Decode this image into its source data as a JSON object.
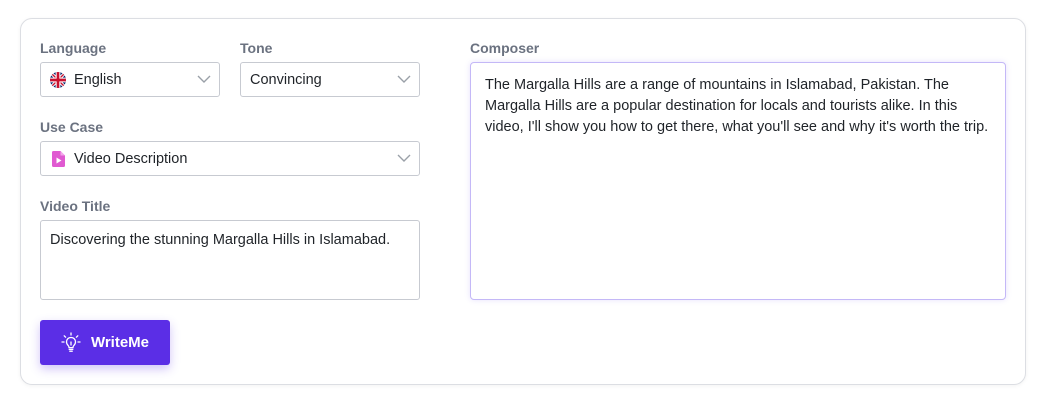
{
  "fields": {
    "language": {
      "label": "Language",
      "value": "English",
      "icon": "uk-flag-icon"
    },
    "tone": {
      "label": "Tone",
      "value": "Convincing"
    },
    "use_case": {
      "label": "Use Case",
      "value": "Video Description",
      "icon": "video-file-icon"
    },
    "video_title": {
      "label": "Video Title",
      "value": "Discovering the stunning Margalla Hills in Islamabad."
    }
  },
  "composer": {
    "label": "Composer",
    "text": "The Margalla Hills are a range of mountains in Islamabad, Pakistan. The Margalla Hills are a popular destination for locals and tourists alike. In this video, I'll show you how to get there, what you'll see and why it's worth the trip."
  },
  "button": {
    "label": "WriteMe",
    "icon": "lightbulb-icon"
  },
  "colors": {
    "accent": "#5b2ee6",
    "label_gray": "#6b7280",
    "border": "#c7cad1",
    "composer_border": "#c4b8f7",
    "use_case_icon": "#d946c4"
  }
}
